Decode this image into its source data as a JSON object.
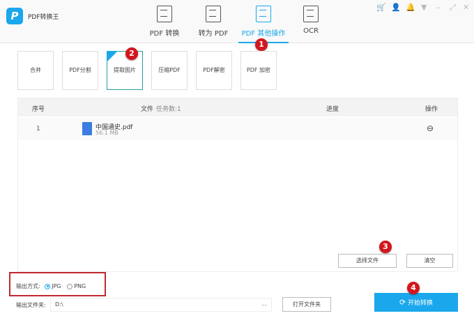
{
  "app": {
    "title": "PDF转换王",
    "logo_letter": "P"
  },
  "nav": [
    {
      "label": "PDF 转换",
      "icon": "pdf-convert-icon"
    },
    {
      "label": "转为 PDF",
      "icon": "to-pdf-icon"
    },
    {
      "label": "PDF 其他操作",
      "icon": "pdf-other-icon",
      "active": true
    },
    {
      "label": "OCR",
      "icon": "ocr-icon"
    }
  ],
  "window_controls": {
    "cart": "🛒",
    "user": "👤",
    "bell": "🔔",
    "menu": "▼",
    "minimize": "–",
    "maximize": "⤢",
    "close": "✕"
  },
  "tools": [
    {
      "label": "合并"
    },
    {
      "label": "PDF分割"
    },
    {
      "label": "提取图片",
      "active": true
    },
    {
      "label": "压缩PDF"
    },
    {
      "label": "PDF解密"
    },
    {
      "label": "PDF 加密"
    }
  ],
  "table": {
    "headers": {
      "index": "序号",
      "file": "文件",
      "task_count": "任务数:1",
      "progress": "进度",
      "action": "操作"
    },
    "rows": [
      {
        "index": "1",
        "name": "中国通史.pdf",
        "size": "56.1 MB",
        "action_icon": "⊖"
      }
    ]
  },
  "buttons": {
    "select_file": "选择文件",
    "clear": "清空",
    "open_folder": "打开文件夹",
    "browse": "...",
    "start": "开始转换"
  },
  "output": {
    "mode_label": "输出方式:",
    "options": [
      "JPG",
      "PNG"
    ],
    "selected": "JPG",
    "folder_label": "输出文件夹:",
    "folder_value": "D:\\"
  },
  "badges": [
    "1",
    "2",
    "3",
    "4"
  ],
  "colors": {
    "accent": "#1aa7ec",
    "badge": "#d2161d",
    "highlight_box": "#c0282e"
  }
}
